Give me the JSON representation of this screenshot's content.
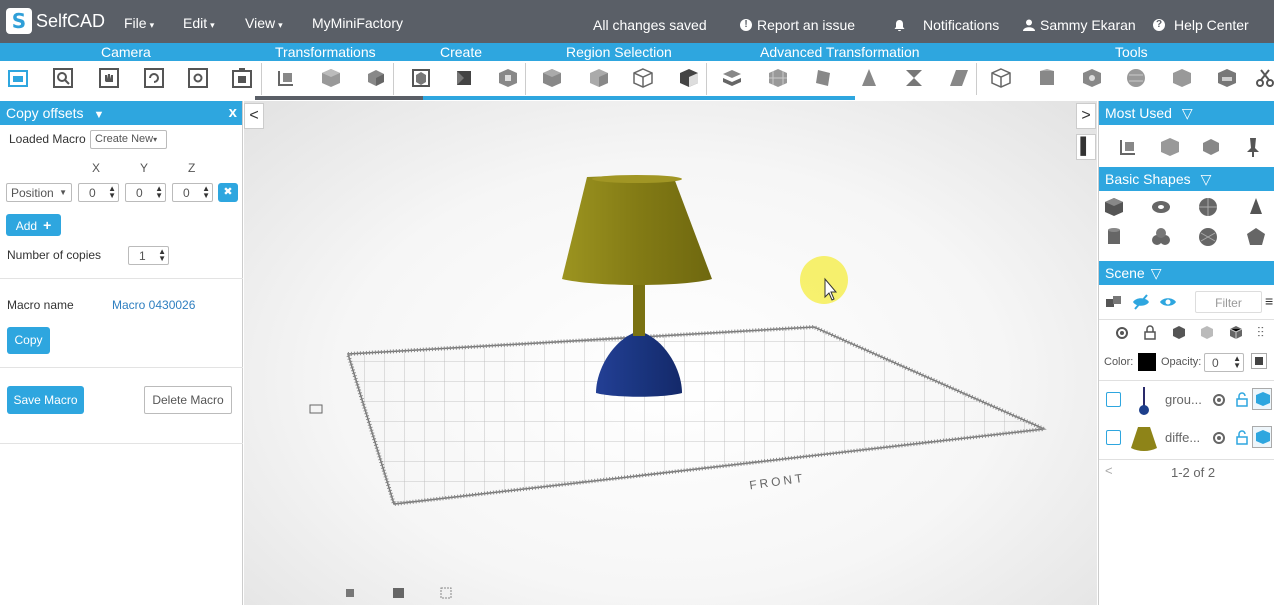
{
  "app": {
    "logo": "SelfCAD",
    "menus": [
      "File",
      "Edit",
      "View"
    ],
    "project": "MyMiniFactory",
    "status": "All changes saved",
    "report": "Report an issue",
    "notifications": "Notifications",
    "user": "Sammy Ekaran",
    "help": "Help Center"
  },
  "tabs": [
    "Camera",
    "Transformations",
    "Create",
    "Region Selection",
    "Advanced Transformation",
    "Tools"
  ],
  "left_panel": {
    "title": "Copy offsets",
    "close": "x",
    "loaded_macro_label": "Loaded Macro",
    "loaded_macro_value": "Create New",
    "axes": [
      "X",
      "Y",
      "Z"
    ],
    "position_select": "Position",
    "offsets": [
      "0",
      "0",
      "0"
    ],
    "remove": "✖",
    "add_label": "Add",
    "copies_label": "Number of copies",
    "copies_value": "1",
    "macro_name_label": "Macro name",
    "macro_name_value": "Macro 0430026",
    "copy_label": "Copy",
    "save_label": "Save Macro",
    "delete_label": "Delete Macro"
  },
  "viewport": {
    "front_label": "FRONT",
    "collapse_left": "<",
    "collapse_right": ">",
    "lamp_colors": {
      "shade": "#8e8418",
      "base": "#1d3f8c",
      "stem": "#7a7212"
    }
  },
  "right_panel": {
    "most_used": "Most Used",
    "basic_shapes": "Basic Shapes",
    "scene": "Scene",
    "filter_placeholder": "Filter",
    "color_label": "Color:",
    "opacity_label": "Opacity:",
    "opacity_value": "0",
    "items": [
      {
        "name": "grou..."
      },
      {
        "name": "diffe..."
      }
    ],
    "pagination": "1-2 of 2"
  },
  "colors": {
    "accent": "#2ea6df",
    "topbar": "#5a5f67"
  }
}
